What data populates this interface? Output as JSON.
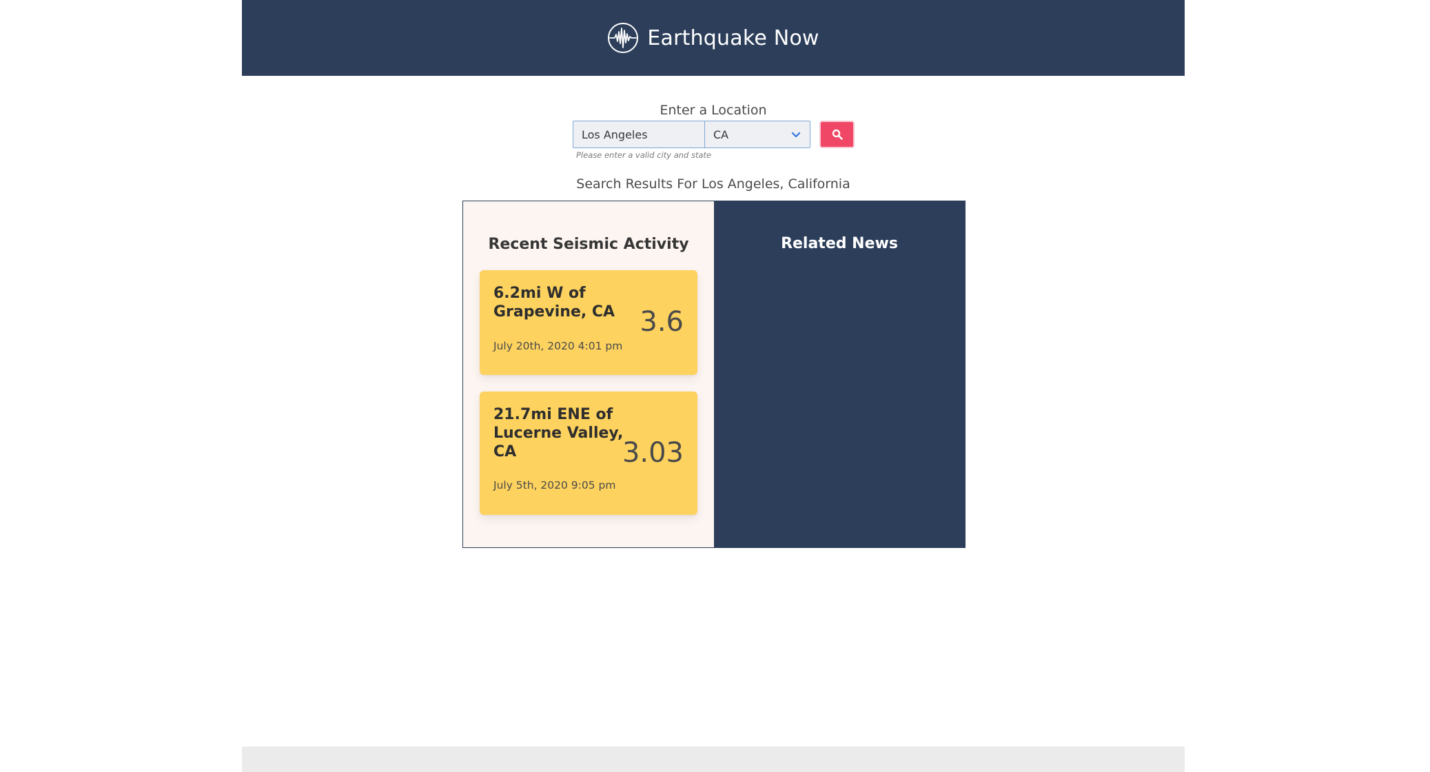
{
  "header": {
    "title": "Earthquake Now",
    "logo_icon": "seismograph-icon",
    "background_color": "#2c3e5a"
  },
  "search": {
    "label": "Enter a Location",
    "city_value": "Los Angeles",
    "state_value": "CA",
    "state_icon": "chevron-down-icon",
    "button_icon": "search-icon",
    "button_color": "#f04766",
    "help_text": "Please enter a valid city and state"
  },
  "results": {
    "heading": "Search Results For Los Angeles, California",
    "seismic": {
      "title": "Recent Seismic Activity",
      "card_color": "#fdd25e",
      "quakes": [
        {
          "place": "6.2mi W of Grapevine, CA",
          "time": "July 20th, 2020 4:01 pm",
          "magnitude": "3.6"
        },
        {
          "place": "21.7mi ENE of Lucerne Valley, CA",
          "time": "July 5th, 2020 9:05 pm",
          "magnitude": "3.03"
        }
      ]
    },
    "news": {
      "title": "Related News"
    }
  }
}
